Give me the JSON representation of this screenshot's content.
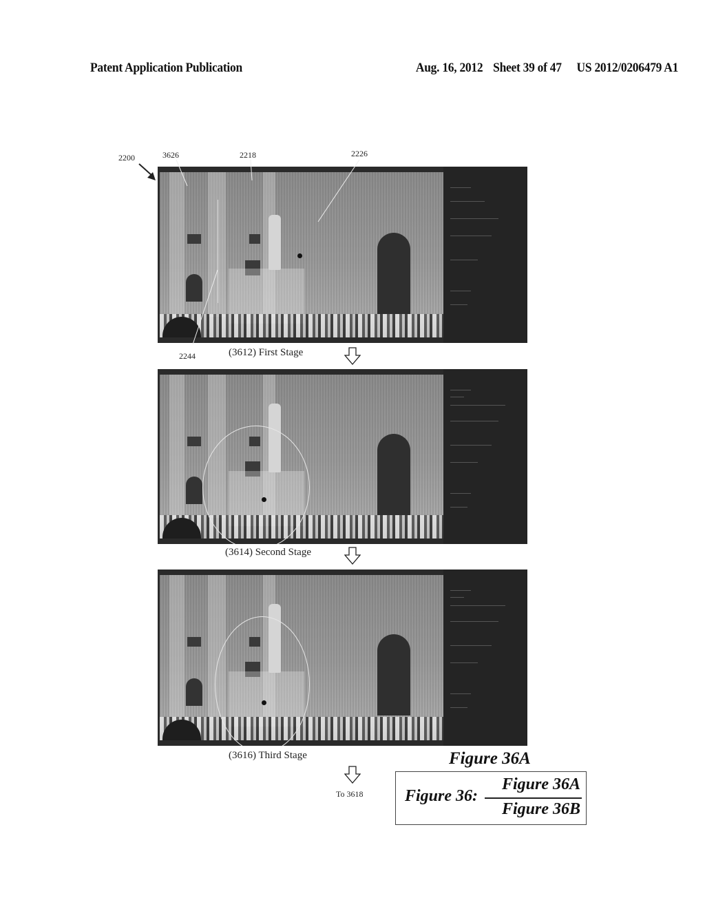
{
  "header": {
    "publication": "Patent Application Publication",
    "date": "Aug. 16, 2012",
    "sheet": "Sheet 39 of 47",
    "patent_number": "US 2012/0206479 A1"
  },
  "reference_labels": {
    "device": "2200",
    "side_panel": "3626",
    "image_area": "2218",
    "selection": "2226",
    "cursor": "2244"
  },
  "stages": [
    {
      "caption": "(3612) First Stage",
      "selection_shown": false
    },
    {
      "caption": "(3614) Second Stage",
      "selection_shown": true
    },
    {
      "caption": "(3616) Third Stage",
      "selection_shown": true
    }
  ],
  "continuation": "To 3618",
  "figure": {
    "title": "Figure 36A",
    "layout_label": "Figure 36:",
    "layout_top": "Figure 36A",
    "layout_bottom": "Figure 36B"
  },
  "icons": {
    "down_arrow": "hollow-down-arrow-icon",
    "pointer_arrow": "pointer-arrow-icon"
  },
  "colors": {
    "panel_bg": "#2a2a2a",
    "text": "#111111"
  }
}
